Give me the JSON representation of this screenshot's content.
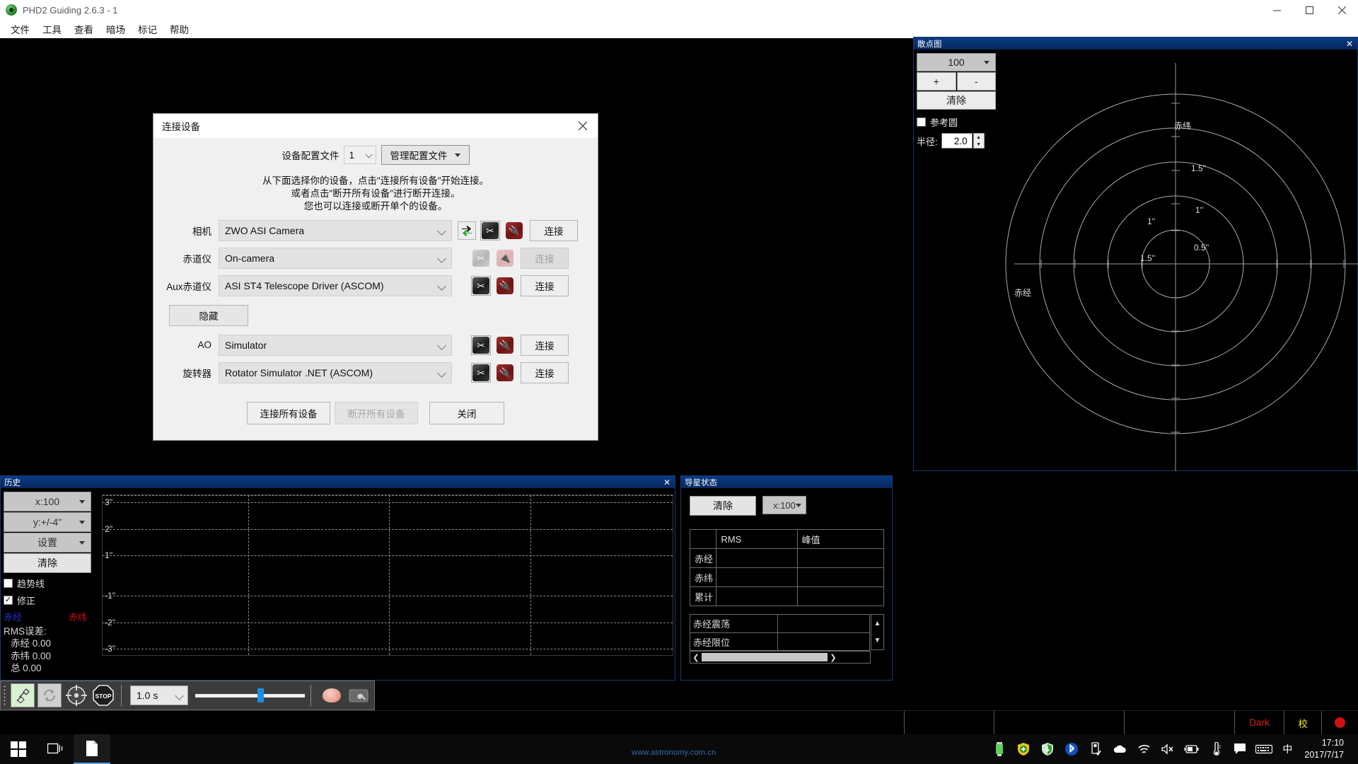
{
  "window": {
    "title": "PHD2 Guiding 2.6.3 - 1",
    "app_icon": "phd2-guiding-icon",
    "minimize": "minimize-icon",
    "maximize": "maximize-icon",
    "close": "close-icon"
  },
  "menubar": {
    "items": [
      {
        "label": "文件"
      },
      {
        "label": "工具"
      },
      {
        "label": "查看"
      },
      {
        "label": "暗场"
      },
      {
        "label": "标记"
      },
      {
        "label": "帮助"
      }
    ]
  },
  "dialog": {
    "title": "连接设备",
    "close_label": "✕",
    "profile": {
      "label": "设备配置文件",
      "value": "1",
      "manage_button": "管理配置文件"
    },
    "instructions": [
      "从下面选择你的设备，点击\"连接所有设备\"开始连接。",
      "或者点击\"断开所有设备\"进行断开连接。",
      "您也可以连接或断开单个的设备。"
    ],
    "rows": [
      {
        "label": "相机",
        "value": "ZWO ASI Camera",
        "has_swap": true,
        "swap_icon": "swap-arrows-icon",
        "tools_icon": "tools-icon",
        "plug_icon": "plug-icon",
        "connect_label": "连接",
        "disabled": false
      },
      {
        "label": "赤道仪",
        "value": "On-camera",
        "has_swap": false,
        "tools_icon": "tools-icon",
        "plug_icon": "plug-icon",
        "connect_label": "连接",
        "disabled": true
      },
      {
        "label": "Aux赤道仪",
        "value": "ASI ST4 Telescope Driver (ASCOM)",
        "has_swap": false,
        "tools_icon": "tools-icon",
        "plug_icon": "plug-icon",
        "connect_label": "连接",
        "disabled": false
      }
    ],
    "hide_button": "隐藏",
    "rows2": [
      {
        "label": "AO",
        "value": "Simulator",
        "tools_icon": "tools-icon",
        "plug_icon": "plug-icon",
        "connect_label": "连接",
        "disabled": false
      },
      {
        "label": "旋转器",
        "value": "Rotator Simulator .NET (ASCOM)",
        "tools_icon": "tools-icon",
        "plug_icon": "plug-icon",
        "connect_label": "连接",
        "disabled": false
      }
    ],
    "footer": {
      "connect_all": "连接所有设备",
      "disconnect_all": "断开所有设备",
      "close": "关闭"
    }
  },
  "scatter_panel": {
    "title": "散点图",
    "close_label": "✕",
    "length_value": "100",
    "plus": "+",
    "minus": "-",
    "clear": "清除",
    "ref_circle_label": "参考圆",
    "ref_circle_checked": false,
    "radius_label": "半径:",
    "radius_value": "2.0",
    "axis_y_label": "赤纬",
    "axis_x_label": "赤经",
    "ring_labels": [
      "1.5''",
      "1''",
      "0.5''"
    ]
  },
  "history_panel": {
    "title": "历史",
    "close_label": "✕",
    "x_scale": "x:100",
    "y_scale": "y:+/-4\"",
    "settings": "设置",
    "clear": "清除",
    "trend_label": "趋势线",
    "trend_checked": false,
    "correction_label": "修正",
    "correction_checked": true,
    "legend_ra": "赤经",
    "legend_dec": "赤纬",
    "rms_title": "RMS误差:",
    "rms_ra": "赤经 0.00",
    "rms_dec": "赤纬 0.00",
    "rms_total": "总 0.00",
    "graph_labels": [
      "3''",
      "2''",
      "1''",
      "-1''",
      "-2''",
      "-3''"
    ]
  },
  "guide_panel": {
    "title": "导星状态",
    "close_label": "✕",
    "clear": "清除",
    "x_scale": "x:100",
    "table": {
      "headers": [
        "",
        "RMS",
        "峰值"
      ],
      "rows": [
        {
          "label": "赤经",
          "rms": "",
          "peak": ""
        },
        {
          "label": "赤纬",
          "rms": "",
          "peak": ""
        },
        {
          "label": "累计",
          "rms": "",
          "peak": ""
        }
      ]
    },
    "list": [
      {
        "key": "赤经震荡",
        "value": ""
      },
      {
        "key": "赤经限位",
        "value": ""
      }
    ]
  },
  "toolbar": {
    "connect_icon": "connect-plug-icon",
    "loop_icon": "loop-refresh-icon",
    "guide_icon": "crosshair-guide-icon",
    "stop_icon": "stop-icon",
    "exposure_value": "1.0 s",
    "gamma_slider_value": 57,
    "brain_icon": "brain-settings-icon",
    "camera_settings_icon": "camera-wrench-icon"
  },
  "statusbar": {
    "dark_label": "Dark",
    "calibration_label": "校",
    "recording_indicator": "red-dot-icon"
  },
  "taskbar": {
    "start_icon": "windows-start-icon",
    "taskview_icon": "task-view-icon",
    "explorer_icon": "file-explorer-icon",
    "tray_icons": [
      "usb-battery-icon",
      "shield-plus-icon",
      "security-shield-icon",
      "bluetooth-icon",
      "usb-eject-icon",
      "onedrive-cloud-icon",
      "wifi-icon",
      "volume-muted-icon",
      "battery-charging-icon",
      "thermometer-icon",
      "notification-icon",
      "keyboard-icon"
    ],
    "ime_label": "中",
    "time": "17:10",
    "date": "2017/7/17"
  },
  "watermark": "www.astronomy.com.cn"
}
